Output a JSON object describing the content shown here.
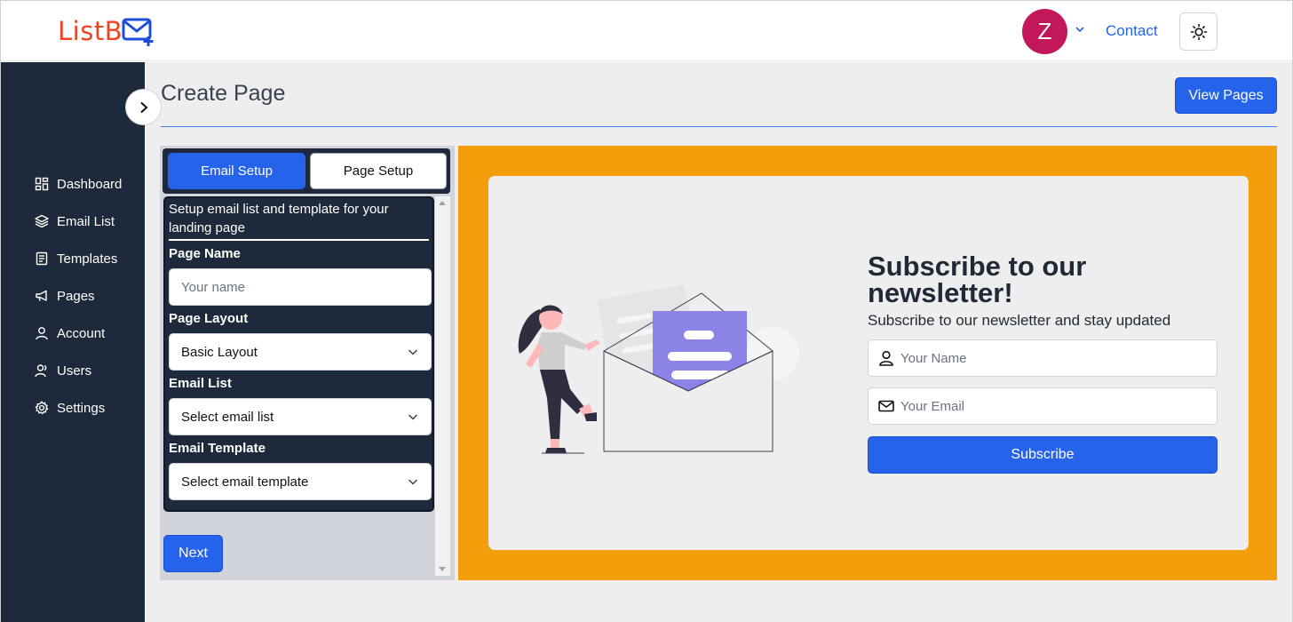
{
  "header": {
    "logo_text": "ListB",
    "avatar_letter": "Z",
    "contact_label": "Contact"
  },
  "sidebar": {
    "items": [
      {
        "label": "Dashboard",
        "icon": "dashboard-icon"
      },
      {
        "label": "Email List",
        "icon": "layers-icon"
      },
      {
        "label": "Templates",
        "icon": "templates-icon"
      },
      {
        "label": "Pages",
        "icon": "megaphone-icon"
      },
      {
        "label": "Account",
        "icon": "user-icon"
      },
      {
        "label": "Users",
        "icon": "users-icon"
      },
      {
        "label": "Settings",
        "icon": "gear-icon"
      }
    ]
  },
  "main": {
    "title": "Create Page",
    "view_pages_label": "View Pages"
  },
  "setup": {
    "tabs": [
      {
        "label": "Email Setup",
        "active": true
      },
      {
        "label": "Page Setup",
        "active": false
      }
    ],
    "description": "Setup email list and template for your landing page",
    "page_name_label": "Page Name",
    "page_name_placeholder": "Your name",
    "page_layout_label": "Page Layout",
    "page_layout_value": "Basic Layout",
    "email_list_label": "Email List",
    "email_list_value": "Select email list",
    "email_template_label": "Email Template",
    "email_template_value": "Select email template",
    "next_label": "Next"
  },
  "preview": {
    "title": "Subscribe to our newsletter!",
    "subtitle": "Subscribe to our newsletter and stay updated",
    "name_placeholder": "Your Name",
    "email_placeholder": "Your Email",
    "subscribe_label": "Subscribe"
  },
  "colors": {
    "primary": "#2563eb",
    "sidebar_bg": "#1e293b",
    "preview_bg": "#f59e0b",
    "avatar_bg": "#c2185b",
    "logo_red": "#ef4423"
  }
}
